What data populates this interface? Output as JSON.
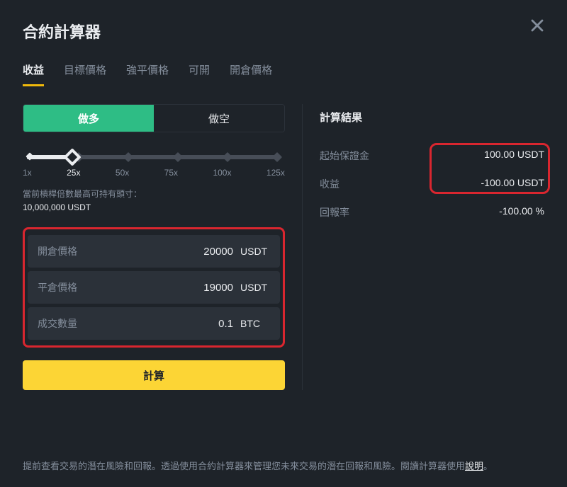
{
  "title": "合約計算器",
  "tabs": [
    {
      "label": "收益",
      "active": true
    },
    {
      "label": "目標價格",
      "active": false
    },
    {
      "label": "強平價格",
      "active": false
    },
    {
      "label": "可開",
      "active": false
    },
    {
      "label": "開倉價格",
      "active": false
    }
  ],
  "side": {
    "long_label": "做多",
    "short_label": "做空"
  },
  "leverage": {
    "marks": [
      "1x",
      "25x",
      "50x",
      "75x",
      "100x",
      "125x"
    ],
    "active_index": 1,
    "note_prefix": "當前槓桿倍數最高可持有頭寸：",
    "note_value": "10,000,000 USDT"
  },
  "inputs": [
    {
      "label": "開倉價格",
      "value": "20000",
      "unit": "USDT"
    },
    {
      "label": "平倉價格",
      "value": "19000",
      "unit": "USDT"
    },
    {
      "label": "成交數量",
      "value": "0.1",
      "unit": "BTC"
    }
  ],
  "calc_btn": "計算",
  "result": {
    "title": "計算結果",
    "rows": [
      {
        "label": "起始保證金",
        "value": "100.00 USDT"
      },
      {
        "label": "收益",
        "value": "-100.00 USDT"
      },
      {
        "label": "回報率",
        "value": "-100.00 %"
      }
    ]
  },
  "footer": {
    "text_a": "提前查看交易的潛在風險和回報。透過使用合約計算器來管理您未來交易的潛在回報和風險。閱讀計算器使用",
    "link": "說明",
    "text_b": "。"
  }
}
